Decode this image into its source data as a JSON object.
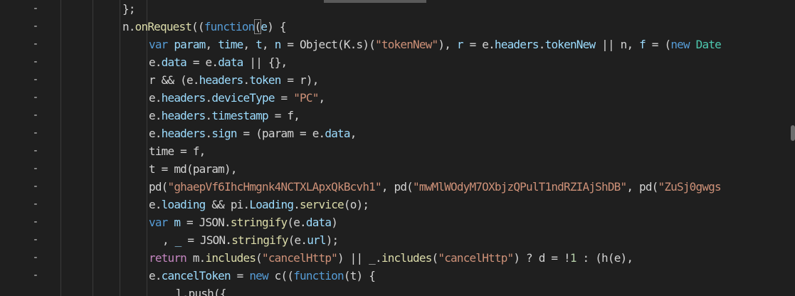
{
  "gutter": {
    "markers": [
      "-",
      "-",
      "-",
      "-",
      "-",
      "-",
      "-",
      "-",
      "-",
      "-",
      "-",
      "-",
      "-",
      "-",
      "-",
      "-"
    ]
  },
  "code_lines": [
    [
      {
        "t": "};",
        "c": "plain"
      }
    ],
    [
      {
        "t": "n.",
        "c": "plain"
      },
      {
        "t": "onRequest",
        "c": "fn"
      },
      {
        "t": "((",
        "c": "plain"
      },
      {
        "t": "function",
        "c": "kw"
      },
      {
        "t": "(",
        "c": "plain",
        "cursor": true
      },
      {
        "t": "e",
        "c": "var"
      },
      {
        "t": ") {",
        "c": "plain"
      }
    ],
    [
      {
        "t": "var",
        "c": "kw"
      },
      {
        "t": " ",
        "c": "plain"
      },
      {
        "t": "param",
        "c": "var"
      },
      {
        "t": ", ",
        "c": "plain"
      },
      {
        "t": "time",
        "c": "var"
      },
      {
        "t": ", ",
        "c": "plain"
      },
      {
        "t": "t",
        "c": "var"
      },
      {
        "t": ", ",
        "c": "plain"
      },
      {
        "t": "n",
        "c": "var"
      },
      {
        "t": " = Object(K.s)(",
        "c": "plain"
      },
      {
        "t": "\"tokenNew\"",
        "c": "str"
      },
      {
        "t": "), ",
        "c": "plain"
      },
      {
        "t": "r",
        "c": "var"
      },
      {
        "t": " = e.",
        "c": "plain"
      },
      {
        "t": "headers",
        "c": "prop"
      },
      {
        "t": ".",
        "c": "plain"
      },
      {
        "t": "tokenNew",
        "c": "prop"
      },
      {
        "t": " || n, ",
        "c": "plain"
      },
      {
        "t": "f",
        "c": "var"
      },
      {
        "t": " = (",
        "c": "plain"
      },
      {
        "t": "new",
        "c": "kw"
      },
      {
        "t": " ",
        "c": "plain"
      },
      {
        "t": "Date",
        "c": "cls"
      }
    ],
    [
      {
        "t": "e.",
        "c": "plain"
      },
      {
        "t": "data",
        "c": "prop"
      },
      {
        "t": " = e.",
        "c": "plain"
      },
      {
        "t": "data",
        "c": "prop"
      },
      {
        "t": " || {},",
        "c": "plain"
      }
    ],
    [
      {
        "t": "r && (e.",
        "c": "plain"
      },
      {
        "t": "headers",
        "c": "prop"
      },
      {
        "t": ".",
        "c": "plain"
      },
      {
        "t": "token",
        "c": "prop"
      },
      {
        "t": " = r),",
        "c": "plain"
      }
    ],
    [
      {
        "t": "e.",
        "c": "plain"
      },
      {
        "t": "headers",
        "c": "prop"
      },
      {
        "t": ".",
        "c": "plain"
      },
      {
        "t": "deviceType",
        "c": "prop"
      },
      {
        "t": " = ",
        "c": "plain"
      },
      {
        "t": "\"PC\"",
        "c": "str"
      },
      {
        "t": ",",
        "c": "plain"
      }
    ],
    [
      {
        "t": "e.",
        "c": "plain"
      },
      {
        "t": "headers",
        "c": "prop"
      },
      {
        "t": ".",
        "c": "plain"
      },
      {
        "t": "timestamp",
        "c": "prop"
      },
      {
        "t": " = f,",
        "c": "plain"
      }
    ],
    [
      {
        "t": "e.",
        "c": "plain"
      },
      {
        "t": "headers",
        "c": "prop"
      },
      {
        "t": ".",
        "c": "plain"
      },
      {
        "t": "sign",
        "c": "prop"
      },
      {
        "t": " = (param = e.",
        "c": "plain"
      },
      {
        "t": "data",
        "c": "prop"
      },
      {
        "t": ",",
        "c": "plain"
      }
    ],
    [
      {
        "t": "time = f,",
        "c": "plain"
      }
    ],
    [
      {
        "t": "t = md(param),",
        "c": "plain"
      }
    ],
    [
      {
        "t": "pd(",
        "c": "plain"
      },
      {
        "t": "\"ghaepVf6IhcHmgnk4NCTXLApxQkBcvh1\"",
        "c": "str"
      },
      {
        "t": ", pd(",
        "c": "plain"
      },
      {
        "t": "\"mwMlWOdyM7OXbjzQPulT1ndRZIAjShDB\"",
        "c": "str"
      },
      {
        "t": ", pd(",
        "c": "plain"
      },
      {
        "t": "\"ZuSj0gwgs",
        "c": "str"
      }
    ],
    [
      {
        "t": "e.",
        "c": "plain"
      },
      {
        "t": "loading",
        "c": "prop"
      },
      {
        "t": " && pi.",
        "c": "plain"
      },
      {
        "t": "Loading",
        "c": "prop"
      },
      {
        "t": ".",
        "c": "plain"
      },
      {
        "t": "service",
        "c": "fn"
      },
      {
        "t": "(o);",
        "c": "plain"
      }
    ],
    [
      {
        "t": "var",
        "c": "kw"
      },
      {
        "t": " ",
        "c": "plain"
      },
      {
        "t": "m",
        "c": "var"
      },
      {
        "t": " = JSON.",
        "c": "plain"
      },
      {
        "t": "stringify",
        "c": "fn"
      },
      {
        "t": "(e.",
        "c": "plain"
      },
      {
        "t": "data",
        "c": "prop"
      },
      {
        "t": ")",
        "c": "plain"
      }
    ],
    [
      {
        "t": ", ",
        "c": "plain"
      },
      {
        "t": "_",
        "c": "var"
      },
      {
        "t": " = JSON.",
        "c": "plain"
      },
      {
        "t": "stringify",
        "c": "fn"
      },
      {
        "t": "(e.",
        "c": "plain"
      },
      {
        "t": "url",
        "c": "prop"
      },
      {
        "t": ");",
        "c": "plain"
      }
    ],
    [
      {
        "t": "return",
        "c": "ctrl"
      },
      {
        "t": " m.",
        "c": "plain"
      },
      {
        "t": "includes",
        "c": "fn"
      },
      {
        "t": "(",
        "c": "plain"
      },
      {
        "t": "\"cancelHttp\"",
        "c": "str"
      },
      {
        "t": ") || _.",
        "c": "plain"
      },
      {
        "t": "includes",
        "c": "fn"
      },
      {
        "t": "(",
        "c": "plain"
      },
      {
        "t": "\"cancelHttp\"",
        "c": "str"
      },
      {
        "t": ") ? d = !",
        "c": "plain"
      },
      {
        "t": "1",
        "c": "num"
      },
      {
        "t": " : (h(e),",
        "c": "plain"
      }
    ],
    [
      {
        "t": "e.",
        "c": "plain"
      },
      {
        "t": "cancelToken",
        "c": "prop"
      },
      {
        "t": " = ",
        "c": "plain"
      },
      {
        "t": "new",
        "c": "kw"
      },
      {
        "t": " c((",
        "c": "plain"
      },
      {
        "t": "function",
        "c": "kw"
      },
      {
        "t": "(t) {",
        "c": "plain"
      }
    ],
    [
      {
        "t": "l.push({",
        "c": "plain"
      }
    ]
  ],
  "colors": {
    "background": "#1f1f1f",
    "plain": "#d4d4d4",
    "keyword": "#569cd6",
    "variable": "#9cdcfe",
    "string": "#ce9178",
    "function": "#dcdcaa",
    "control": "#c586c0",
    "number": "#b5cea8",
    "class": "#4ec9b0"
  }
}
